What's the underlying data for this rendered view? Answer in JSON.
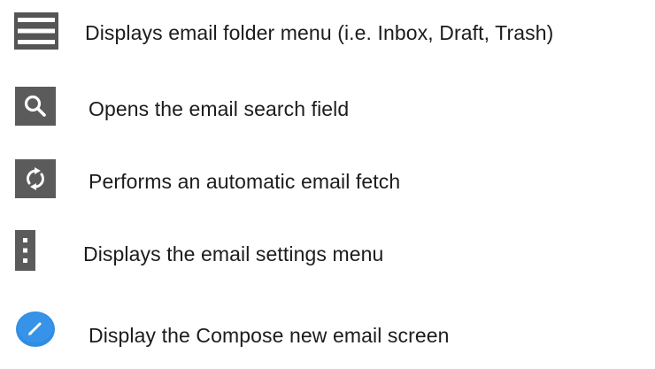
{
  "legend": {
    "items": [
      {
        "icon": "hamburger-menu-icon",
        "label": "Displays email folder menu (i.e. Inbox, Draft, Trash)"
      },
      {
        "icon": "search-icon",
        "label": "Opens the email search field"
      },
      {
        "icon": "refresh-icon",
        "label": "Performs an automatic email fetch"
      },
      {
        "icon": "more-vertical-icon",
        "label": "Displays the email settings menu"
      },
      {
        "icon": "compose-icon",
        "label": "Display the Compose new email screen"
      }
    ]
  },
  "colors": {
    "icon_tile": "#5b5b5b",
    "icon_glyph": "#ffffff",
    "compose_accent": "#2f8de4",
    "text": "#1c1c1c"
  }
}
